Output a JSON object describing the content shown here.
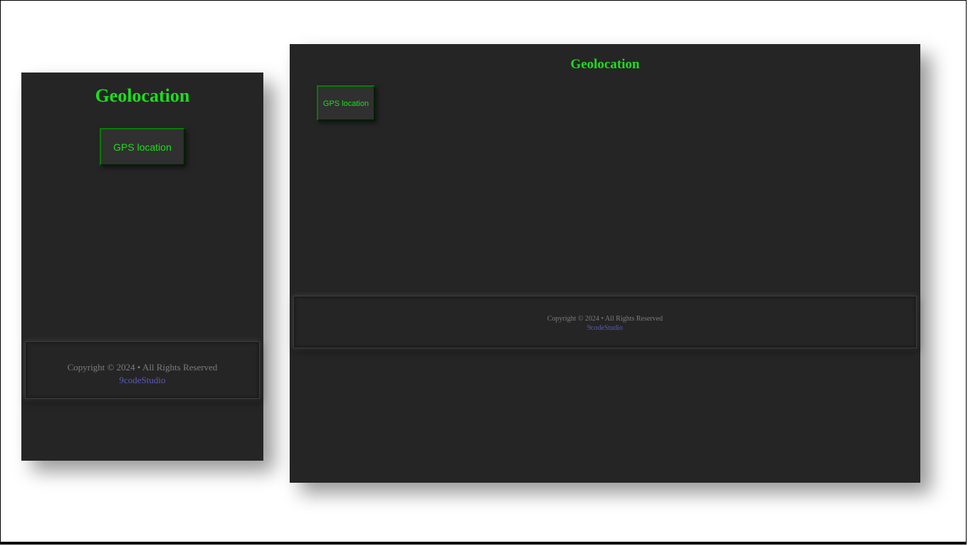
{
  "left": {
    "title": "Geolocation",
    "button_label": "GPS location",
    "footer": {
      "copyright": "Copyright © 2024 • All Rights Reserved",
      "link_text": "9codeStudio"
    }
  },
  "right": {
    "title": "Geolocation",
    "button_label": "GPS location",
    "footer": {
      "copyright": "Copyright © 2024 • All Rights Reserved",
      "link_text": "9codeStudio"
    }
  }
}
